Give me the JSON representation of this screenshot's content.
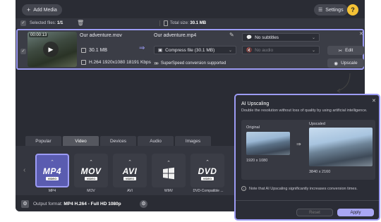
{
  "toolbar": {
    "add_media": "Add Media",
    "settings": "Settings",
    "help": "?"
  },
  "info": {
    "selected_label": "Selected files:",
    "selected_value": "1/1",
    "total_label": "Total size:",
    "total_value": "30.1 MB"
  },
  "file": {
    "time": "00:00:13",
    "source_name": "Our adventure.mov",
    "source_size": "30.1 MB",
    "source_codec": "H.264 1920x1080 18191 Kbps",
    "output_name": "Our adventure.mp4",
    "subtitles": "No subtitles",
    "compress": "Compress file (30.1 MB)",
    "audio": "No audio",
    "superspeed": "SuperSpeed conversion supported",
    "edit_label": "Edit",
    "upscale_label": "Upscale"
  },
  "tabs": [
    "Popular",
    "Video",
    "Devices",
    "Audio",
    "Images"
  ],
  "active_tab": "Video",
  "formats": [
    {
      "logo": "MP4",
      "sub": "VIDEO",
      "label": "MP4",
      "active": true
    },
    {
      "logo": "MOV",
      "sub": "VIDEO",
      "label": "MOV",
      "active": false
    },
    {
      "logo": "AVI",
      "sub": "VIDEO",
      "label": "AVI",
      "active": false
    },
    {
      "logo": "",
      "sub": "",
      "label": "WMV",
      "active": false
    },
    {
      "logo": "DVD",
      "sub": "VIDEO",
      "label": "DVD-Compatible ...",
      "active": false
    }
  ],
  "output": {
    "label": "Output format:",
    "value": "MP4 H.264 - Full HD 1080p"
  },
  "panel": {
    "title": "AI Upscaling",
    "description": "Double the resolution without loss of quality by using artificial intelligence.",
    "original_label": "Original",
    "original_res": "1920 x 1080",
    "upscaled_label": "Upscaled",
    "upscaled_res": "3840 x 2160",
    "note": "Note that AI Upscaling significantly increases conversion times.",
    "reset": "Reset",
    "apply": "Apply"
  },
  "colors": {
    "accent": "#9d9cf5",
    "help": "#f4c235",
    "apply": "#a9a7f4"
  }
}
